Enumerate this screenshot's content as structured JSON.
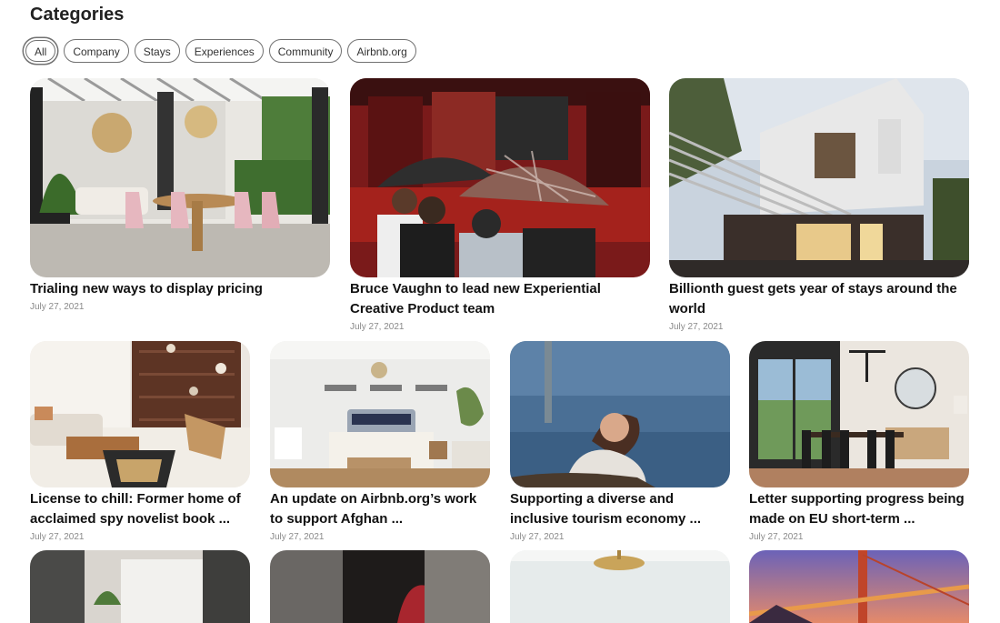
{
  "heading": "Categories",
  "filters": [
    "All",
    "Company",
    "Stays",
    "Experiences",
    "Community",
    "Airbnb.org"
  ],
  "row1": [
    {
      "title": "Trialing new ways to display pricing",
      "date": "July 27, 2021"
    },
    {
      "title": "Bruce Vaughn to lead new Experiential Creative Product team",
      "date": "July 27, 2021"
    },
    {
      "title": "Billionth guest gets year of stays around the world",
      "date": "July 27, 2021"
    }
  ],
  "row2": [
    {
      "title": "License to chill: Former home of acclaimed spy novelist book ...",
      "date": "July 27, 2021"
    },
    {
      "title": "An update on Airbnb.org’s work to support Afghan ...",
      "date": "July 27, 2021"
    },
    {
      "title": "Supporting a diverse and inclusive tourism economy ...",
      "date": "July 27, 2021"
    },
    {
      "title": "Letter supporting progress being made on EU short-term ...",
      "date": "July 27, 2021"
    }
  ]
}
